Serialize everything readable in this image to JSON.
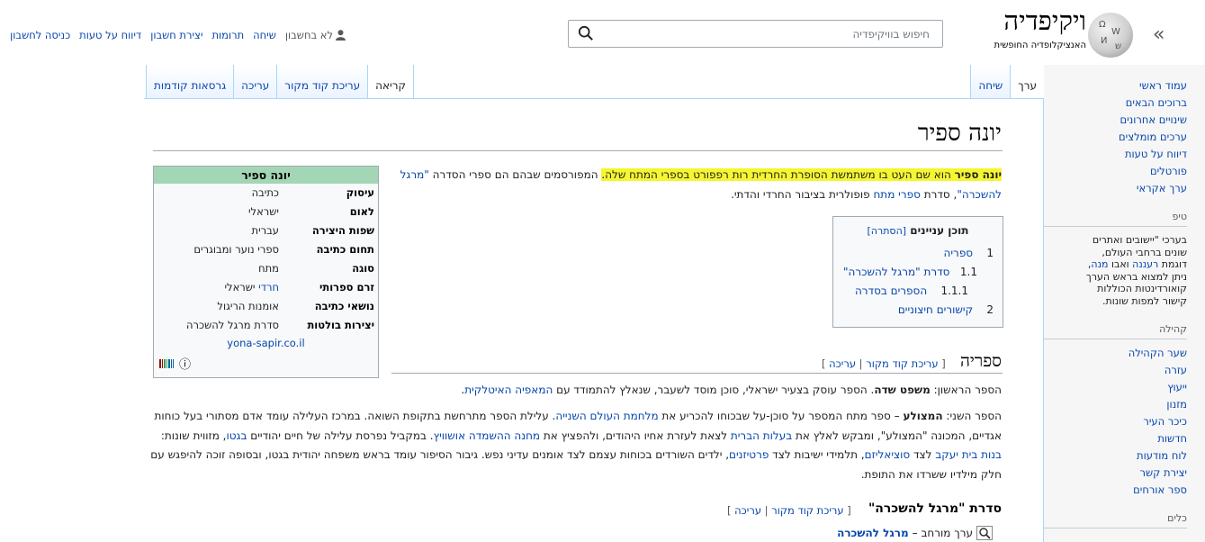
{
  "header": {
    "collapse_glyph": "«",
    "logo_title": "ויקיפדיה",
    "logo_subtitle": "האנציקלופדיה החופשית",
    "search_placeholder": "חיפוש בוויקיפדיה",
    "user": {
      "anon": "לא בחשבון",
      "links": [
        "שיחה",
        "תרומות",
        "יצירת חשבון",
        "דיווח על טעות",
        "כניסה לחשבון"
      ]
    }
  },
  "nav": {
    "main": [
      "עמוד ראשי",
      "ברוכים הבאים",
      "שינויים אחרונים",
      "ערכים מומלצים",
      "דיווח על טעות",
      "פורטלים",
      "ערך אקראי"
    ],
    "tip_heading": "טיפ",
    "tip_text": [
      "בערכי \"יישובים ואתרים",
      "שונים ברחבי העולם,",
      "דוגמת ",
      "רעננה",
      " ואבו ",
      "מנה",
      ",",
      "ניתן למצוא בראש הערך",
      "קואורדינטות הכוללות",
      "קישור למפות שונות."
    ],
    "community_heading": "קהילה",
    "community": [
      "שער הקהילה",
      "עזרה",
      "ייעוץ",
      "מזנון",
      "כיכר העיר",
      "חדשות",
      "לוח מודעות",
      "יצירת קשר",
      "ספר אורחים"
    ],
    "tools_heading": "כלים"
  },
  "tabs": {
    "left": [
      "ערך",
      "שיחה"
    ],
    "right": [
      "קריאה",
      "עריכת קוד מקור",
      "עריכה",
      "גרסאות קודמות"
    ]
  },
  "article": {
    "title": "יונה ספיר",
    "lead": {
      "bold": "יונה ספיר",
      "hl_rest": " הוא שם העט בו משתמשת הסופרת החרדית רות רפפורט בספרי המתח שלה.",
      "rest": " המפורסמים שבהם הם ספרי הסדרה ",
      "series_link": "\"מרגל להשכרה\"",
      "mid": ", סדרת ",
      "genre_link": "ספרי מתח",
      "end": " פופולרית בציבור החרדי והדתי."
    },
    "toc": {
      "title": "תוכן עניינים",
      "toggle": "[הסתרה]",
      "items": [
        {
          "num": "1",
          "text": "ספריה"
        },
        {
          "num": "1.1",
          "text": "סדרת \"מרגל להשכרה\""
        },
        {
          "num": "1.1.1",
          "text": "הספרים בסדרה"
        },
        {
          "num": "2",
          "text": "קישורים חיצוניים"
        }
      ]
    },
    "section1": {
      "title": "ספריה",
      "edit_src": "עריכת קוד מקור",
      "edit": "עריכה",
      "p1": {
        "a": "הספר הראשון: ",
        "b": "משפט שדה",
        "c": ". הספר עוסק בצעיר ישראלי, סוכן מוסד לשעבר, שנאלץ להתמודד עם ",
        "link": "המאפיה האיטלקית",
        "d": "."
      },
      "p2": {
        "a": "הספר השני: ",
        "b": "המצולע",
        "c": " – ספר מתח המספר על סוכן-על שבכוחו להכריע את ",
        "l1": "מלחמת העולם השנייה",
        "d": ". עלילת הספר מתרחשת בתקופת השואה. במרכז העלילה עומד אדם מסתורי בעל כוחות אגדיים, המכונה \"המצולע\", ומבקש לאלץ את ",
        "l2": "בעלות הברית",
        "e": " לצאת לעזרת אחיו היהודים, ולהפציץ את ",
        "l3": "מחנה ההשמדה אושוויץ",
        "f": ". במקביל נפרסת עלילה של חיים יהודיים ",
        "l4": "בגטו",
        "g": ", מזווית שונות: ",
        "l5": "בנות בית יעקב",
        "h": " לצד ",
        "l6": "סוציאליזם",
        "i": ", תלמידי ישיבות לצד ",
        "l7": "פרטיזנים",
        "j": ", ילדים השורדים בכוחות עצמם לצד אומנים עדיני נפש. גיבור הסיפור עומד בראש משפחה יהודית בגטו, ובסופה זוכה להיפגש עם חלק מילדיו ששרדו את התופת."
      }
    },
    "subsection": {
      "title": "סדרת \"מרגל להשכרה\"",
      "edit_src": "עריכת קוד מקור",
      "edit": "עריכה",
      "main_article_prefix": "ערך מורחב – ",
      "main_article_link": "מרגל להשכרה"
    }
  },
  "infobox": {
    "title": "יונה ספיר",
    "rows": [
      {
        "k": "עיסוק",
        "v": "כתיבה"
      },
      {
        "k": "לאום",
        "v": "ישראלי"
      },
      {
        "k": "שפות היצירה",
        "v": "עברית"
      },
      {
        "k": "תחום כתיבה",
        "v": "ספרי נוער ומבוגרים"
      },
      {
        "k": "סוגה",
        "v": "מתח"
      },
      {
        "k": "זרם ספרותי",
        "v_link": "חרדי",
        "v": " ישראלי"
      },
      {
        "k": "נושאי כתיבה",
        "v": "אומנות הריגול"
      },
      {
        "k": "יצירות בולטות",
        "v": "סדרת מרגל להשכרה"
      }
    ],
    "website": "yona-sapir.co.il",
    "info_glyph": "ⓘ"
  }
}
